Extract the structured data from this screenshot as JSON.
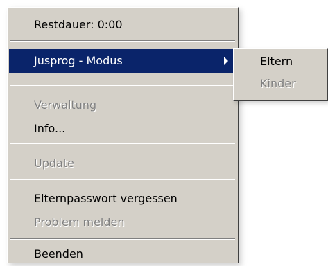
{
  "context_menu": {
    "items": [
      {
        "label": "Restdauer: 0:00",
        "enabled": true
      },
      {
        "label": "Jusprog - Modus",
        "enabled": true,
        "highlighted": true,
        "has_submenu": true,
        "arrow_icon": "chevron-right-icon"
      },
      {
        "label": "Verwaltung",
        "enabled": false
      },
      {
        "label": "Info...",
        "enabled": true
      },
      {
        "label": "Update",
        "enabled": false
      },
      {
        "label": "Elternpasswort vergessen",
        "enabled": true
      },
      {
        "label": "Problem melden",
        "enabled": false
      },
      {
        "label": "Beenden",
        "enabled": true
      }
    ]
  },
  "submenu": {
    "items": [
      {
        "label": "Eltern",
        "enabled": true
      },
      {
        "label": "Kinder",
        "enabled": false
      }
    ]
  },
  "colors": {
    "menu_background": "#d4d0c8",
    "highlight_background": "#0a246a",
    "highlight_text": "#ffffff",
    "disabled_text": "#808080"
  }
}
